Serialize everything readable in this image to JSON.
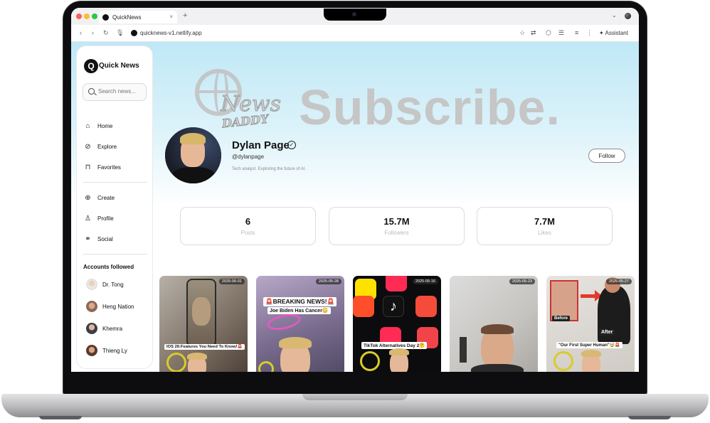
{
  "browser": {
    "tab_title": "QuickNews",
    "tab_close": "×",
    "new_tab": "+",
    "url": "quicknews-v1.netlify.app",
    "assistant_label": "Assistant"
  },
  "sidebar": {
    "logo_letter": "Q",
    "logo_text": "Quick News",
    "search_placeholder": "Search news...",
    "nav": [
      {
        "label": "Home",
        "icon": "home-icon"
      },
      {
        "label": "Explore",
        "icon": "compass-icon"
      },
      {
        "label": "Favorites",
        "icon": "bookmark-icon"
      },
      {
        "label": "Create",
        "icon": "plus-circle-icon"
      },
      {
        "label": "Profile",
        "icon": "user-icon"
      },
      {
        "label": "Social",
        "icon": "link-icon"
      }
    ],
    "accounts_title": "Accounts followed",
    "accounts": [
      {
        "name": "Dr. Tong"
      },
      {
        "name": "Heng Nation"
      },
      {
        "name": "Khemra"
      },
      {
        "name": "Thieng Ly"
      }
    ]
  },
  "banner": {
    "news_word": "News",
    "daddy_word": "DADDY",
    "subscribe_word": "Subscribe."
  },
  "profile": {
    "name": "Dylan Page",
    "verified_mark": "✓",
    "handle": "@dylanpage",
    "bio": "Tech analyst. Exploring the future of AI.",
    "follow_label": "Follow"
  },
  "stats": [
    {
      "value": "6",
      "label": "Posts"
    },
    {
      "value": "15.7M",
      "label": "Followers"
    },
    {
      "value": "7.7M",
      "label": "Likes"
    }
  ],
  "videos": [
    {
      "date": "2025-06-01",
      "caption": "IOS 26:Features You Need To Know!🚨"
    },
    {
      "date": "2025-05-28",
      "caption": "🚨BREAKING NEWS!🚨",
      "caption2": "Joe Biden Has Cancer😳"
    },
    {
      "date": "2025-05-16",
      "caption": "TikTok Alternatives Day 2🤔"
    },
    {
      "date": "2025-05-23",
      "caption": ""
    },
    {
      "date": "2025-05-27",
      "caption": "\"Our First Super Human\"🤯🚨",
      "before": "Before",
      "after": "After"
    }
  ]
}
